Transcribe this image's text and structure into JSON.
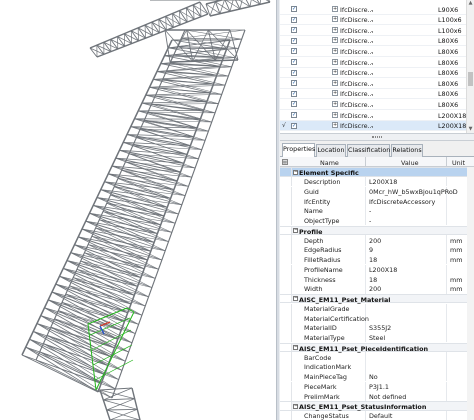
{
  "element_list": {
    "rows": [
      {
        "checked": true,
        "name": "IfcDiscre...",
        "value": "-",
        "profile": "L90X6",
        "selected": false
      },
      {
        "checked": true,
        "name": "IfcDiscre...",
        "value": "-",
        "profile": "L100x6",
        "selected": false
      },
      {
        "checked": true,
        "name": "IfcDiscre...",
        "value": "-",
        "profile": "L100x6",
        "selected": false
      },
      {
        "checked": true,
        "name": "IfcDiscre...",
        "value": "-",
        "profile": "L80X6",
        "selected": false
      },
      {
        "checked": true,
        "name": "IfcDiscre...",
        "value": "-",
        "profile": "L80X6",
        "selected": false
      },
      {
        "checked": true,
        "name": "IfcDiscre...",
        "value": "-",
        "profile": "L80X6",
        "selected": false
      },
      {
        "checked": true,
        "name": "IfcDiscre...",
        "value": "-",
        "profile": "L80X6",
        "selected": false
      },
      {
        "checked": true,
        "name": "IfcDiscre...",
        "value": "-",
        "profile": "L80X6",
        "selected": false
      },
      {
        "checked": true,
        "name": "IfcDiscre...",
        "value": "-",
        "profile": "L80X6",
        "selected": false
      },
      {
        "checked": true,
        "name": "IfcDiscre...",
        "value": "-",
        "profile": "L80X6",
        "selected": false
      },
      {
        "checked": true,
        "name": "IfcDiscre...",
        "value": "-",
        "profile": "L200X18",
        "selected": false
      },
      {
        "checked": true,
        "name": "IfcDiscre...",
        "value": "-",
        "profile": "L200X18",
        "selected": true
      }
    ]
  },
  "tabs": [
    {
      "label": "Properties",
      "active": true
    },
    {
      "label": "Location",
      "active": false
    },
    {
      "label": "Classification",
      "active": false
    },
    {
      "label": "Relations",
      "active": false
    }
  ],
  "prop_header": {
    "name": "Name",
    "value": "Value",
    "unit": "Unit"
  },
  "prop_rows": [
    {
      "kind": "section",
      "label": "Element Specific",
      "selected": true
    },
    {
      "kind": "prop",
      "label": "Description",
      "value": "L200X18",
      "unit": ""
    },
    {
      "kind": "prop",
      "label": "Guid",
      "value": "0Mcr_hW_b5wxBjou1qPRoD",
      "unit": ""
    },
    {
      "kind": "prop",
      "label": "IfcEntity",
      "value": "IfcDiscreteAccessory",
      "unit": ""
    },
    {
      "kind": "prop",
      "label": "Name",
      "value": "-",
      "unit": ""
    },
    {
      "kind": "prop",
      "label": "ObjectType",
      "value": "-",
      "unit": ""
    },
    {
      "kind": "section",
      "label": "Profile",
      "selected": false
    },
    {
      "kind": "prop",
      "label": "Depth",
      "value": "200",
      "unit": "mm"
    },
    {
      "kind": "prop",
      "label": "EdgeRadius",
      "value": "9",
      "unit": "mm"
    },
    {
      "kind": "prop",
      "label": "FilletRadius",
      "value": "18",
      "unit": "mm"
    },
    {
      "kind": "prop",
      "label": "ProfileName",
      "value": "L200X18",
      "unit": ""
    },
    {
      "kind": "prop",
      "label": "Thickness",
      "value": "18",
      "unit": "mm"
    },
    {
      "kind": "prop",
      "label": "Width",
      "value": "200",
      "unit": "mm"
    },
    {
      "kind": "section",
      "label": "AISC_EM11_Pset_Material",
      "selected": false
    },
    {
      "kind": "prop",
      "label": "MaterialGrade",
      "value": "",
      "unit": ""
    },
    {
      "kind": "prop",
      "label": "MaterialCertification",
      "value": "",
      "unit": ""
    },
    {
      "kind": "prop",
      "label": "MaterialID",
      "value": "S355J2",
      "unit": ""
    },
    {
      "kind": "prop",
      "label": "MaterialType",
      "value": "Steel",
      "unit": ""
    },
    {
      "kind": "section",
      "label": "AISC_EM11_Pset_PieceIdentification",
      "selected": false
    },
    {
      "kind": "prop",
      "label": "BarCode",
      "value": "",
      "unit": ""
    },
    {
      "kind": "prop",
      "label": "IndicationMark",
      "value": "",
      "unit": ""
    },
    {
      "kind": "prop",
      "label": "MainPieceTag",
      "value": "No",
      "unit": ""
    },
    {
      "kind": "prop",
      "label": "PieceMark",
      "value": "P3J1.1",
      "unit": ""
    },
    {
      "kind": "prop",
      "label": "PrelimMark",
      "value": "Not defined",
      "unit": ""
    },
    {
      "kind": "section",
      "label": "AISC_EM11_Pset_StatusInformation",
      "selected": false
    },
    {
      "kind": "prop",
      "label": "ChangeStatus",
      "value": "Default",
      "unit": ""
    }
  ],
  "icons": {
    "expand": "plus-box-icon",
    "collapse": "minus-box-icon",
    "check": "checkmark-icon"
  },
  "colors": {
    "selection": "#b9d3ef",
    "steel": "#6f747a",
    "highlight": "#22b51a"
  }
}
